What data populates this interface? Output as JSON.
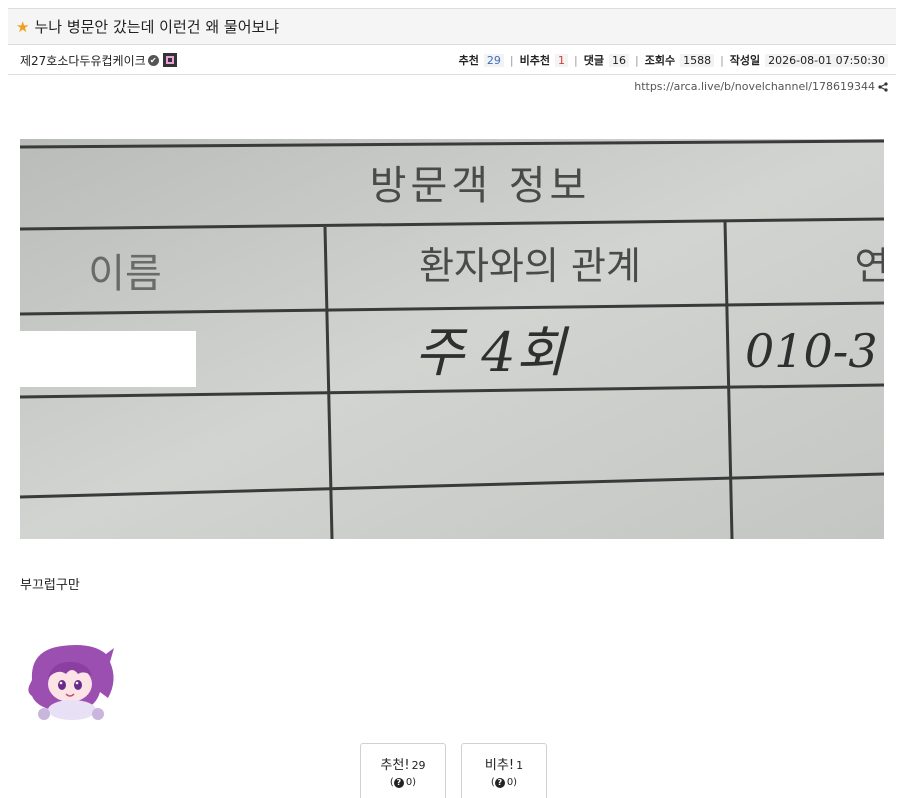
{
  "post": {
    "title": "누나 병문안 갔는데 이런건 왜 물어보냐",
    "author": "제27호소다두유컵케이크",
    "stats": {
      "recommend_label": "추천",
      "recommend": "29",
      "unrecommend_label": "비추천",
      "unrecommend": "1",
      "comments_label": "댓글",
      "comments": "16",
      "views_label": "조회수",
      "views": "1588",
      "date_label": "작성일",
      "date": "2026-08-01 07:50:30"
    },
    "url": "https://arca.live/b/novelchannel/178619344",
    "body_text": "부끄럽구만"
  },
  "photo": {
    "heading": "방문객 정보",
    "col_name": "이름",
    "col_relation": "환자와의 관계",
    "col_contact": "연",
    "handwritten_relation": "주 4회",
    "handwritten_phone": "010-3"
  },
  "votes": {
    "up_label": "추천!",
    "up_count": "29",
    "up_sub": "0)",
    "down_label": "비추!",
    "down_count": "1",
    "down_sub": "0)"
  },
  "colors": {
    "star": "#f0a01e",
    "recommend": "#3a6fc2",
    "unrecommend": "#d23c3c"
  }
}
